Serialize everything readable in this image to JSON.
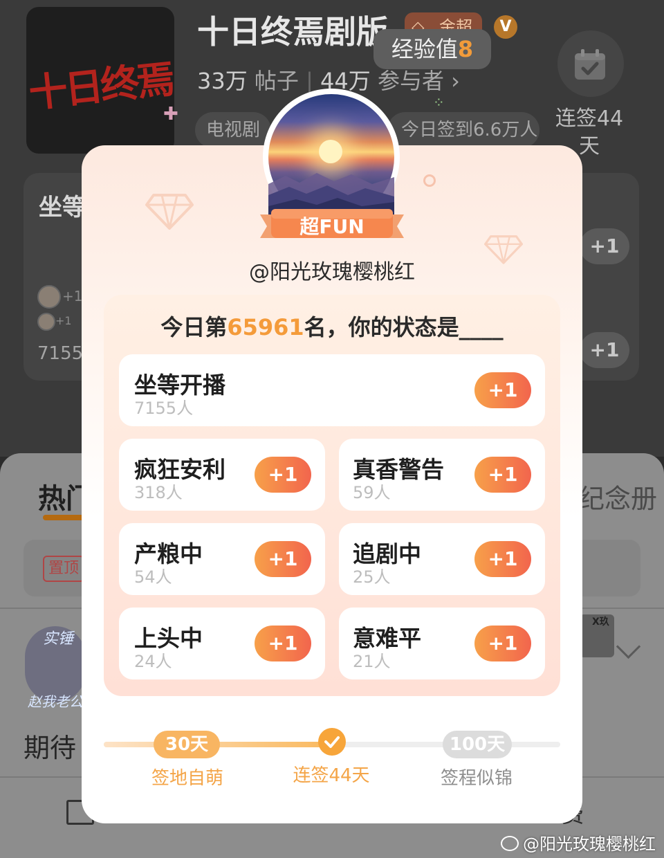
{
  "topic": {
    "cover_text": "十日终焉",
    "title": "十日终焉剧版",
    "tier": "金超",
    "verified_mark": "V",
    "exp_label": "经验值",
    "exp_value": "8",
    "posts_count": "33万",
    "posts_label": "帖子",
    "members_count": "44万",
    "members_label": "参与者",
    "category_chip": "电视剧",
    "today_checkin_chip": "今日签到6.6万人",
    "streak_label": "连签44天"
  },
  "background": {
    "card_title": "坐等",
    "plus_label": "+1",
    "small_plus": "+1",
    "count_partial": "7155人",
    "tab_hot": "热门",
    "tab_album": "纪念册",
    "pin_label": "置顶",
    "user_overlay_1": "实锤",
    "user_overlay_2": "赵我老公",
    "avatar_badge": "X玖",
    "post_text": "期待",
    "action_fee": "费"
  },
  "modal": {
    "badge": "超FUN",
    "username": "@阳光玫瑰樱桃红",
    "rank_prefix": "今日第",
    "rank": "65961",
    "rank_suffix": "名，你的状态是____",
    "plus_label": "+1",
    "options": [
      {
        "title": "坐等开播",
        "count": "7155人"
      },
      {
        "title": "疯狂安利",
        "count": "318人"
      },
      {
        "title": "真香警告",
        "count": "59人"
      },
      {
        "title": "产粮中",
        "count": "54人"
      },
      {
        "title": "追剧中",
        "count": "25人"
      },
      {
        "title": "上头中",
        "count": "24人"
      },
      {
        "title": "意难平",
        "count": "21人"
      }
    ],
    "milestones": [
      {
        "pill": "30天",
        "label": "签地自萌",
        "reached": true
      },
      {
        "pill": "",
        "label": "连签44天",
        "current": true
      },
      {
        "pill": "100天",
        "label": "签程似锦",
        "reached": false
      }
    ],
    "progress_fraction": 0.51
  },
  "watermark": "@阳光玫瑰樱桃红",
  "colors": {
    "accent_orange": "#f49b3a",
    "button_gradient_start": "#f7a04a",
    "button_gradient_end": "#f2654d",
    "modal_top": "#fde9df"
  }
}
